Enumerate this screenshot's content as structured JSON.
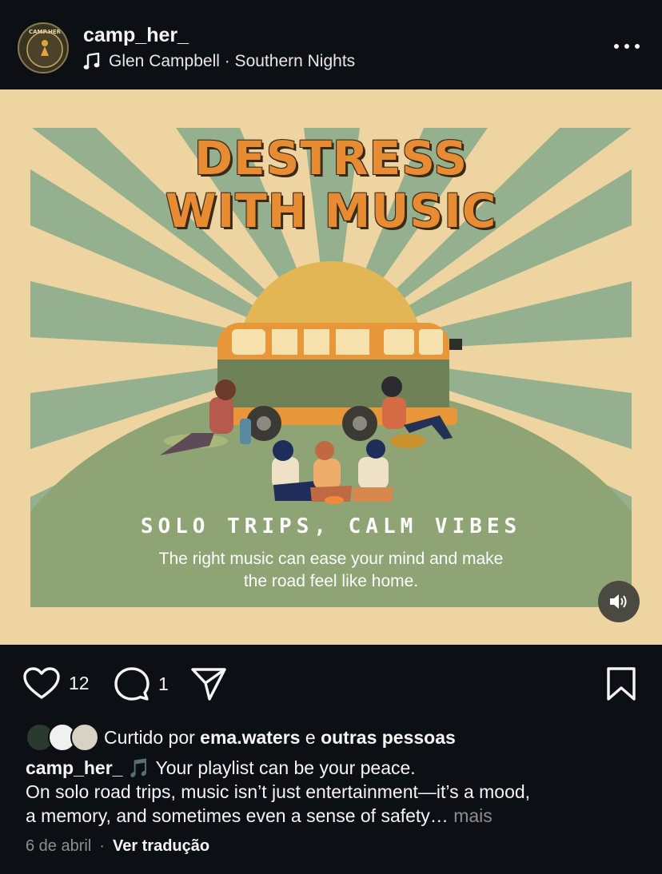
{
  "header": {
    "username": "camp_her_",
    "avatar_text": "CAMP.HER",
    "music": "Glen Campbell · Southern Nights"
  },
  "post": {
    "title_line_1": "DESTRESS",
    "title_line_2": "WITH MUSIC",
    "subtitle": "SOLO TRIPS, CALM VIBES",
    "caption_line_1": "The right music can ease your mind and make",
    "caption_line_2": "the road feel like home."
  },
  "actions": {
    "likes_count": "12",
    "comments_count": "1"
  },
  "liked_by": {
    "prefix": "Curtido por",
    "user": "ema.waters",
    "conjunction": "e",
    "others": "outras pessoas"
  },
  "caption": {
    "username": "camp_her_",
    "emoji": "🎵",
    "line_1": "Your playlist can be your peace.",
    "line_2": "On solo road trips, music isn’t just entertainment—it’s a mood,",
    "line_3": "a memory, and sometimes even a sense of safety…",
    "more": "mais"
  },
  "meta": {
    "date": "6 de abril",
    "separator": "·",
    "translate": "Ver tradução"
  },
  "colors": {
    "background": "#0c1014",
    "poster_bg": "#eed4a1",
    "ray_green": "#95b08e",
    "hill_green": "#8ea474",
    "sun": "#e2b655",
    "title_orange": "#e88c33",
    "bus_orange": "#e8963a",
    "bus_green": "#6f8157",
    "muted_text": "#8e8e8e"
  },
  "icons": {
    "music": "music-note-icon",
    "more": "more-dots-icon",
    "like": "heart-icon",
    "comment": "comment-bubble-icon",
    "share": "paper-plane-icon",
    "save": "bookmark-icon",
    "sound": "speaker-icon"
  }
}
